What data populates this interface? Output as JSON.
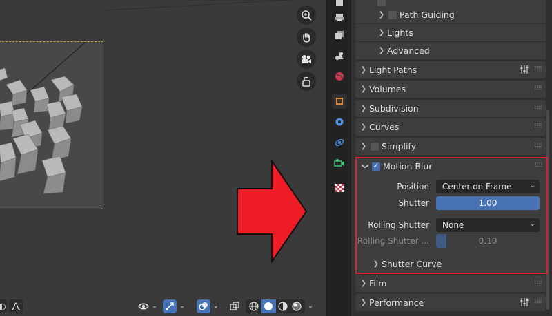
{
  "panel": {
    "sub_items": [
      {
        "label": "Path Guiding",
        "checkbox": false
      },
      {
        "label": "Lights"
      },
      {
        "label": "Advanced"
      }
    ],
    "sections": [
      {
        "label": "Light Paths",
        "has_presets": true
      },
      {
        "label": "Volumes"
      },
      {
        "label": "Subdivision"
      },
      {
        "label": "Curves"
      },
      {
        "label": "Simplify",
        "checkbox": false
      }
    ],
    "motion_blur": {
      "label": "Motion Blur",
      "enabled": true,
      "position_label": "Position",
      "position_value": "Center on Frame",
      "shutter_label": "Shutter",
      "shutter_value": "1.00",
      "rolling_shutter_label": "Rolling Shutter",
      "rolling_shutter_value": "None",
      "rolling_duration_label": "Rolling Shutter ...",
      "rolling_duration_value": "0.10",
      "rolling_duration_fraction": 0.1,
      "shutter_curve_label": "Shutter Curve"
    },
    "after_sections": [
      {
        "label": "Film"
      },
      {
        "label": "Performance",
        "has_presets": true
      }
    ]
  },
  "icons": {
    "viewport_tools": [
      "zoom-icon",
      "hand-pan-icon",
      "camera-view-icon",
      "lock-icon"
    ],
    "properties_tabs": [
      "render-icon",
      "output-icon",
      "view-layer-icon",
      "scene-icon",
      "world-icon",
      "object-icon",
      "modifiers-icon",
      "particles-icon",
      "physics-icon",
      "object-data-icon",
      "texture-icon"
    ]
  },
  "colors": {
    "accent_blue": "#4772b3",
    "highlight_red": "#d9203a",
    "arrow_red": "#ee1c25"
  }
}
